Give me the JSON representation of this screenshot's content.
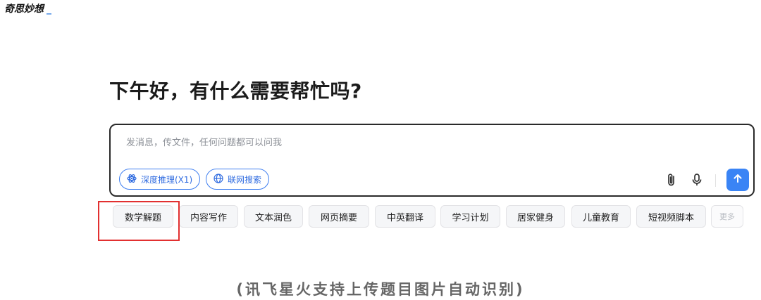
{
  "brand": {
    "title": "奇思妙想",
    "cursor": "_"
  },
  "greeting": "下午好，有什么需要帮忙吗?",
  "composer": {
    "placeholder": "发消息，传文件，任何问题都可以问我",
    "deep_reasoning_label": "深度推理(X1)",
    "web_search_label": "联网搜索",
    "icons": {
      "attach": "paperclip-icon",
      "mic": "microphone-icon",
      "send": "arrow-up-icon"
    }
  },
  "chips": [
    "数学解题",
    "内容写作",
    "文本润色",
    "网页摘要",
    "中英翻译",
    "学习计划",
    "居家健身",
    "儿童教育",
    "短视频脚本",
    "更多"
  ],
  "caption": "(讯飞星火支持上传题目图片自动识别)",
  "colors": {
    "accent": "#3a84f5",
    "highlight": "#e23030"
  }
}
